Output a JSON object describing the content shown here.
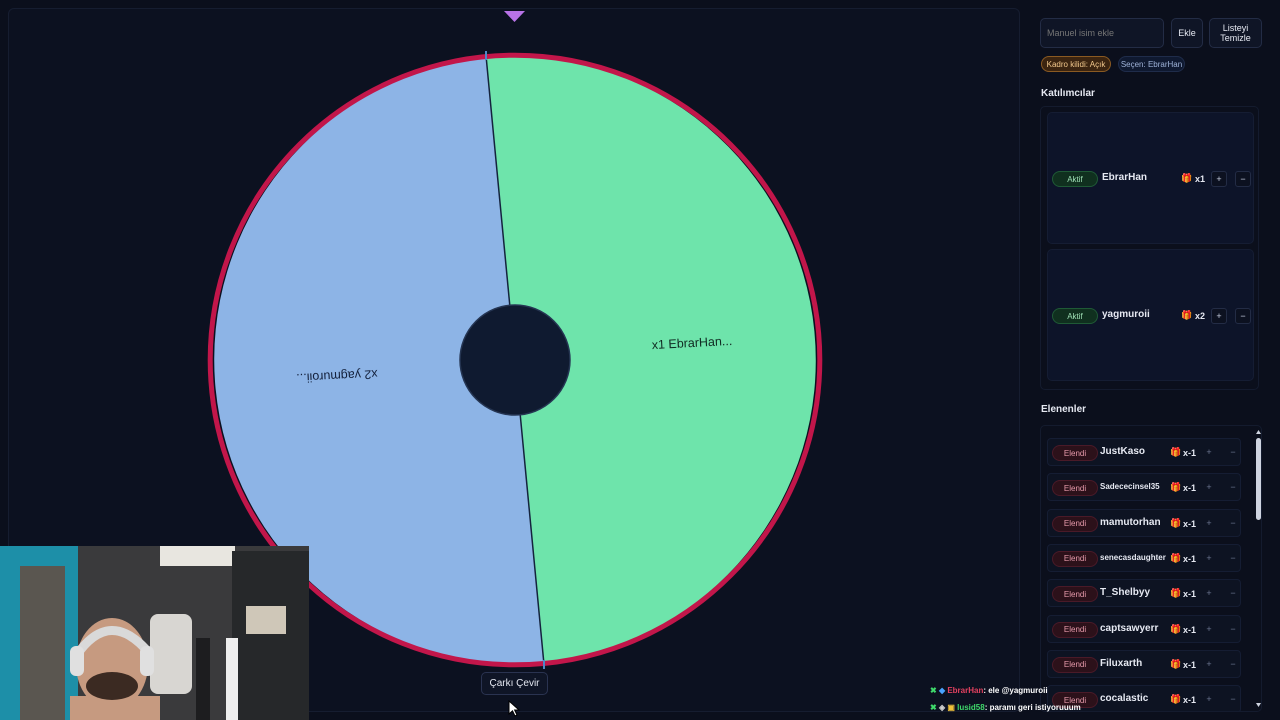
{
  "wheel": {
    "segments": [
      {
        "label": "x1 EbrarHan...",
        "color": "#6ee4ab"
      },
      {
        "label": "x2 yagmuroii...",
        "color": "#8db4e6"
      }
    ],
    "rim_color": "#c2164a",
    "spin_label": "Çarkı Çevir"
  },
  "sidebar": {
    "name_input_placeholder": "Manuel isim ekle",
    "add_label": "Ekle",
    "clear_label_line1": "Listeyi",
    "clear_label_line2": "Temizle",
    "lock_status": "Kadro kilidi: Açık",
    "picker": "Seçen: EbrarHan",
    "participants_title": "Katılımcılar",
    "participants": [
      {
        "status": "Aktif",
        "name": "EbrarHan",
        "mult": "x1"
      },
      {
        "status": "Aktif",
        "name": "yagmuroii",
        "mult": "x2"
      }
    ],
    "eliminated_title": "Elenenler",
    "eliminated": [
      {
        "status": "Elendi",
        "name": "JustKaso",
        "mult": "x-1"
      },
      {
        "status": "Elendi",
        "name": "Sadececinsel35",
        "mult": "x-1"
      },
      {
        "status": "Elendi",
        "name": "mamutorhan",
        "mult": "x-1"
      },
      {
        "status": "Elendi",
        "name": "senecasdaughter",
        "mult": "x-1"
      },
      {
        "status": "Elendi",
        "name": "T_Shelbyy",
        "mult": "x-1"
      },
      {
        "status": "Elendi",
        "name": "captsawyerr",
        "mult": "x-1"
      },
      {
        "status": "Elendi",
        "name": "Filuxarth",
        "mult": "x-1"
      },
      {
        "status": "Elendi",
        "name": "cocalastic",
        "mult": "x-1"
      }
    ],
    "plus": "+",
    "minus": "−"
  },
  "chat": [
    {
      "user": "EbrarHan",
      "text": ": ele @yagmuroii",
      "user_color": "#e2415f"
    },
    {
      "user": "lusid58",
      "text": ": paramı geri istiyoruuum",
      "user_color": "#3fd96b"
    }
  ]
}
